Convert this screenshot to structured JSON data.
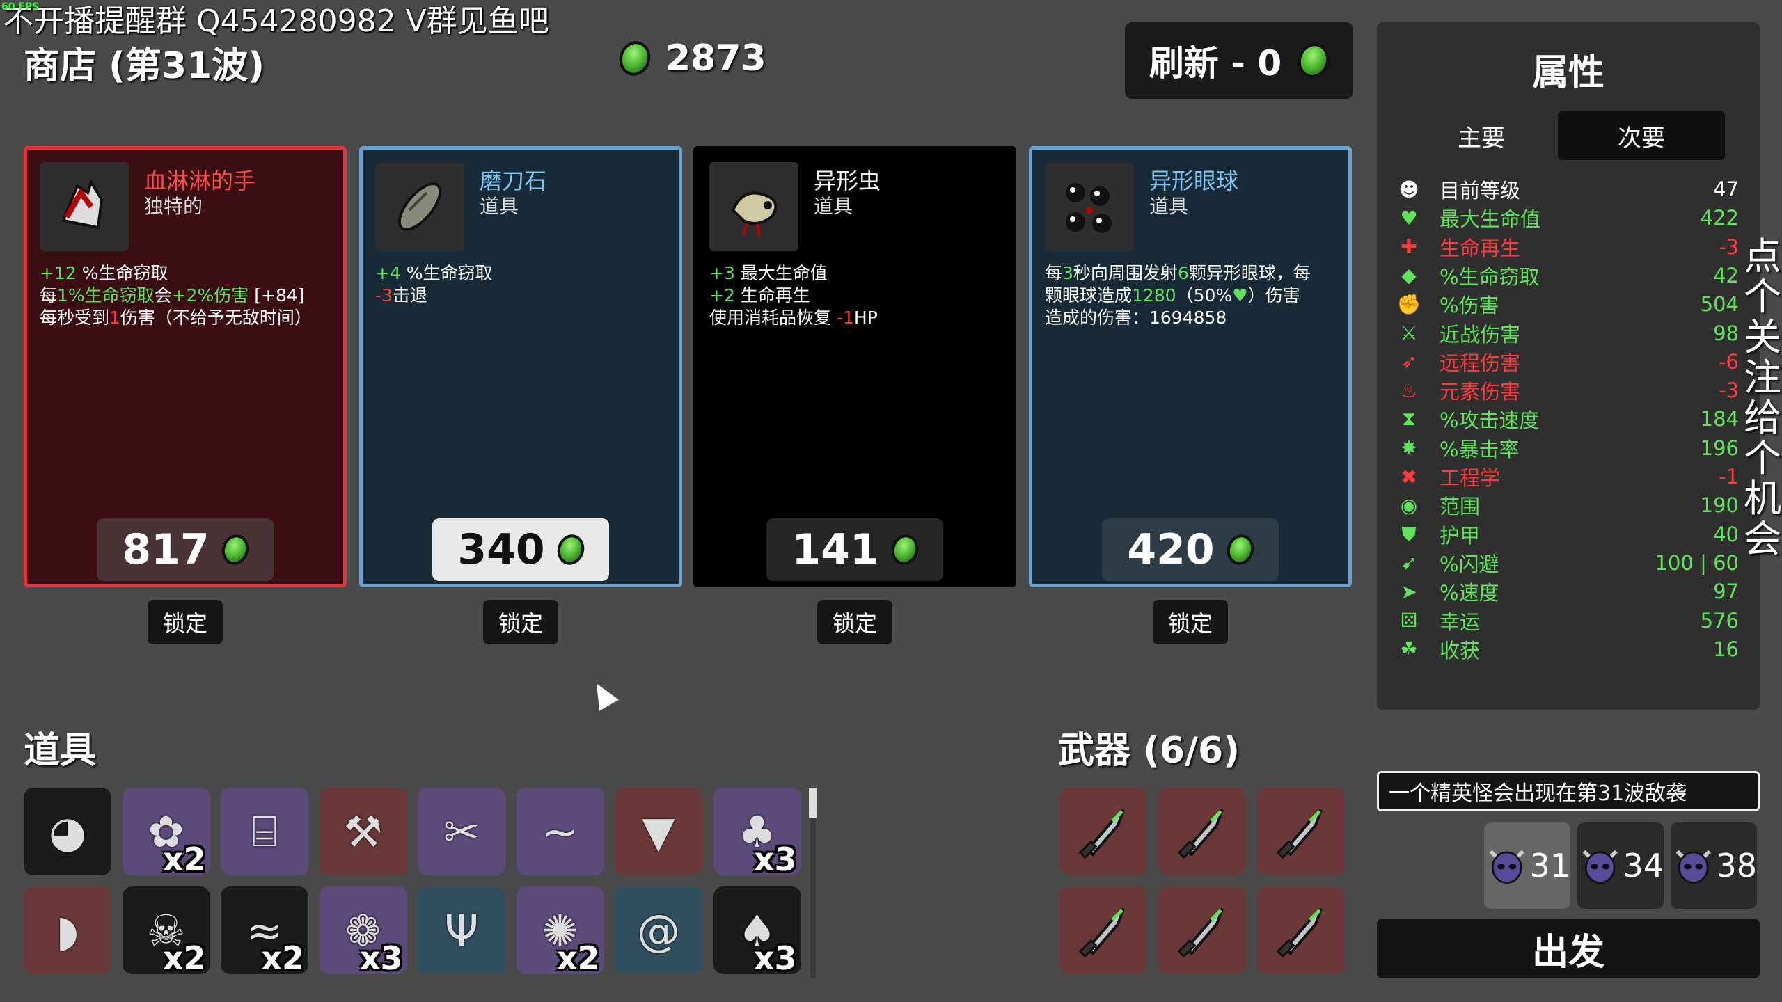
{
  "overlay": {
    "stream_text": "不开播提醒群 Q454280982 V群见鱼吧",
    "fps": "60 FPS"
  },
  "header": {
    "shop_title": "商店 (第31波)",
    "materials": "2873",
    "refresh_label": "刷新 - 0"
  },
  "shop_items": [
    {
      "name": "血淋淋的手",
      "type": "独特的",
      "price": "817",
      "lock_label": "锁定",
      "desc": [
        [
          {
            "t": "+12",
            "c": "g"
          },
          {
            "t": " %生命窃取",
            "c": ""
          }
        ],
        [
          {
            "t": "每",
            "c": ""
          },
          {
            "t": "1%生命窃取",
            "c": "g"
          },
          {
            "t": "会",
            "c": ""
          },
          {
            "t": "+2%伤害",
            "c": "g"
          },
          {
            "t": " [+84]",
            "c": ""
          }
        ],
        [
          {
            "t": "每秒受到",
            "c": ""
          },
          {
            "t": "1",
            "c": "r"
          },
          {
            "t": "伤害（不给予无敌时间）",
            "c": ""
          }
        ]
      ]
    },
    {
      "name": "磨刀石",
      "type": "道具",
      "price": "340",
      "lock_label": "锁定",
      "desc": [
        [
          {
            "t": "+4",
            "c": "g"
          },
          {
            "t": " %生命窃取",
            "c": ""
          }
        ],
        [
          {
            "t": "-3",
            "c": "r"
          },
          {
            "t": "击退",
            "c": ""
          }
        ]
      ]
    },
    {
      "name": "异形虫",
      "type": "道具",
      "price": "141",
      "lock_label": "锁定",
      "desc": [
        [
          {
            "t": "+3",
            "c": "g"
          },
          {
            "t": " 最大生命值",
            "c": ""
          }
        ],
        [
          {
            "t": "+2",
            "c": "g"
          },
          {
            "t": " 生命再生",
            "c": ""
          }
        ],
        [
          {
            "t": "使用消耗品恢复 ",
            "c": ""
          },
          {
            "t": "-1",
            "c": "r"
          },
          {
            "t": "HP",
            "c": ""
          }
        ]
      ]
    },
    {
      "name": "异形眼球",
      "type": "道具",
      "price": "420",
      "lock_label": "锁定",
      "desc": [
        [
          {
            "t": "每",
            "c": ""
          },
          {
            "t": "3",
            "c": "g"
          },
          {
            "t": "秒向周围发射",
            "c": ""
          },
          {
            "t": "6",
            "c": "g"
          },
          {
            "t": "颗异形眼球，每",
            "c": ""
          }
        ],
        [
          {
            "t": "颗眼球造成",
            "c": ""
          },
          {
            "t": "1280",
            "c": "g"
          },
          {
            "t": "（50%",
            "c": ""
          },
          {
            "t": "♥",
            "c": "g"
          },
          {
            "t": "）伤害",
            "c": ""
          }
        ],
        [
          {
            "t": "造成的伤害：1694858",
            "c": ""
          }
        ]
      ]
    }
  ],
  "inventory": {
    "title": "道具",
    "items": [
      {
        "icon": "egg-face-icon",
        "count": ""
      },
      {
        "icon": "peacock-icon",
        "count": "x2"
      },
      {
        "icon": "bottle-icon",
        "count": ""
      },
      {
        "icon": "wand-icon",
        "count": ""
      },
      {
        "icon": "tools-icon",
        "count": ""
      },
      {
        "icon": "bandana-icon",
        "count": ""
      },
      {
        "icon": "cape-icon",
        "count": ""
      },
      {
        "icon": "plant-pot-icon",
        "count": "x3"
      },
      {
        "icon": "stomach-icon",
        "count": ""
      },
      {
        "icon": "skull-icon",
        "count": "x2"
      },
      {
        "icon": "lizard-icon",
        "count": "x2"
      },
      {
        "icon": "tardigrade-icon",
        "count": "x3"
      },
      {
        "icon": "claw-icon",
        "count": ""
      },
      {
        "icon": "angel-robot-icon",
        "count": "x2"
      },
      {
        "icon": "snail-icon",
        "count": ""
      },
      {
        "icon": "sack-icon",
        "count": "x3"
      }
    ]
  },
  "weapons": {
    "title": "武器 (6/6)",
    "items": [
      "knife-icon",
      "knife-icon",
      "knife-icon",
      "knife-icon",
      "knife-icon",
      "knife-icon"
    ]
  },
  "stats_panel": {
    "title": "属性",
    "tab_primary": "主要",
    "tab_secondary": "次要",
    "stats": [
      {
        "label": "目前等级",
        "value": "47",
        "color": "#ffffff",
        "icon": "level-icon",
        "glyph": "☻"
      },
      {
        "label": "最大生命值",
        "value": "422",
        "color": "#5fe35a",
        "icon": "heart-icon",
        "glyph": "♥"
      },
      {
        "label": "生命再生",
        "value": "-3",
        "color": "#ff3b3b",
        "icon": "regen-icon",
        "glyph": "✚"
      },
      {
        "label": "%生命窃取",
        "value": "42",
        "color": "#5fe35a",
        "icon": "lifesteal-icon",
        "glyph": "◆"
      },
      {
        "label": "%伤害",
        "value": "504",
        "color": "#5fe35a",
        "icon": "damage-icon",
        "glyph": "✊"
      },
      {
        "label": "近战伤害",
        "value": "98",
        "color": "#5fe35a",
        "icon": "melee-icon",
        "glyph": "⚔"
      },
      {
        "label": "远程伤害",
        "value": "-6",
        "color": "#ff3b3b",
        "icon": "ranged-icon",
        "glyph": "➶"
      },
      {
        "label": "元素伤害",
        "value": "-3",
        "color": "#ff3b3b",
        "icon": "elemental-icon",
        "glyph": "♨"
      },
      {
        "label": "%攻击速度",
        "value": "184",
        "color": "#5fe35a",
        "icon": "hourglass-icon",
        "glyph": "⧗"
      },
      {
        "label": "%暴击率",
        "value": "196",
        "color": "#5fe35a",
        "icon": "crit-icon",
        "glyph": "✸"
      },
      {
        "label": "工程学",
        "value": "-1",
        "color": "#ff3b3b",
        "icon": "engineering-icon",
        "glyph": "✖"
      },
      {
        "label": "范围",
        "value": "190",
        "color": "#5fe35a",
        "icon": "range-icon",
        "glyph": "◉"
      },
      {
        "label": "护甲",
        "value": "40",
        "color": "#5fe35a",
        "icon": "armor-icon",
        "glyph": "⛊"
      },
      {
        "label": "%闪避",
        "value": "100 | 60",
        "color": "#5fe35a",
        "icon": "dodge-icon",
        "glyph": "➹"
      },
      {
        "label": "%速度",
        "value": "97",
        "color": "#5fe35a",
        "icon": "speed-icon",
        "glyph": "➤"
      },
      {
        "label": "幸运",
        "value": "576",
        "color": "#5fe35a",
        "icon": "luck-icon",
        "glyph": "⚄"
      },
      {
        "label": "收获",
        "value": "16",
        "color": "#5fe35a",
        "icon": "harvest-icon",
        "glyph": "☘"
      }
    ]
  },
  "side_text": "点个关注，给个机会",
  "elite_notice": "一个精英怪会出现在第31波敌袭",
  "bosses": [
    "31",
    "34",
    "38"
  ],
  "go_button": "出发",
  "colors": {
    "unique_border": "#e8333b",
    "unique_bg": "#3a0e13",
    "tier2_border": "#6aa3cf",
    "tier2_bg": "#182a38",
    "common_bg": "#000000",
    "materials_green": "#5fe35a",
    "negative_red": "#ff3b3b"
  }
}
